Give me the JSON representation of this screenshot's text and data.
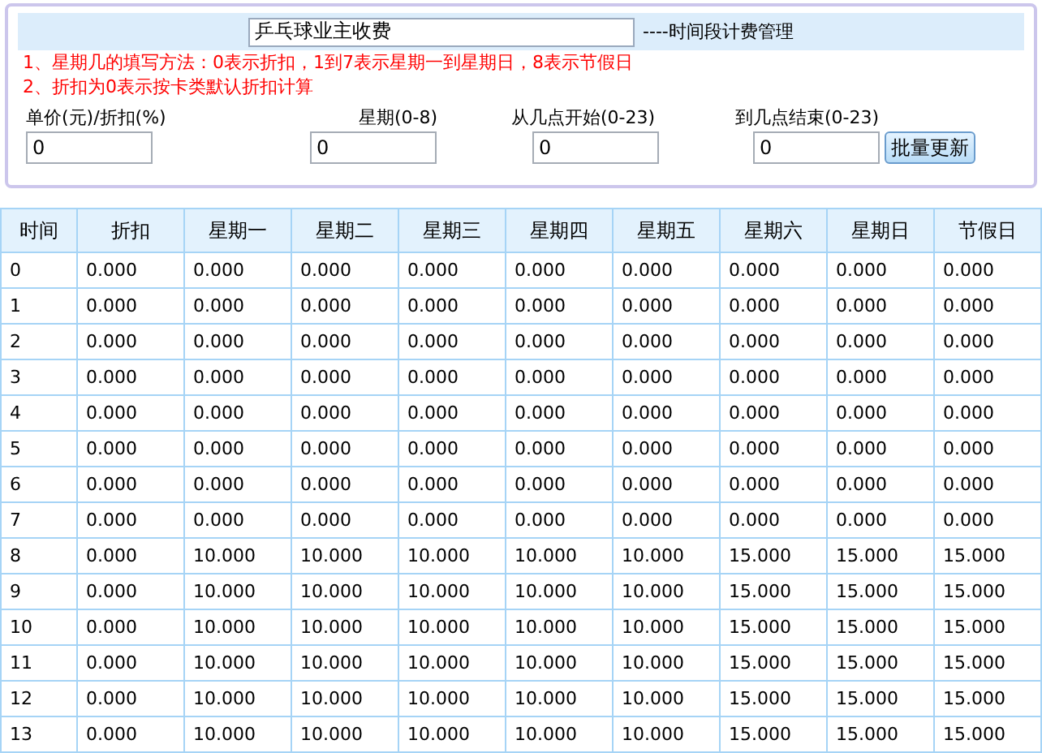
{
  "title_field": {
    "value": "乒乓球业主收费"
  },
  "title_suffix": "----时间段计费管理",
  "notes": [
    "1、星期几的填写方法：0表示折扣，1到7表示星期一到星期日，8表示节假日",
    "2、折扣为0表示按卡类默认折扣计算"
  ],
  "fields": [
    {
      "label": "单价(元)/折扣(%)",
      "value": "0"
    },
    {
      "label": "星期(0-8)",
      "value": "0"
    },
    {
      "label": "从几点开始(0-23)",
      "value": "0"
    },
    {
      "label": "到几点结束(0-23)",
      "value": "0"
    }
  ],
  "update_button": "批量更新",
  "table": {
    "columns": [
      "时间",
      "折扣",
      "星期一",
      "星期二",
      "星期三",
      "星期四",
      "星期五",
      "星期六",
      "星期日",
      "节假日"
    ],
    "rows": [
      [
        "0",
        "0.000",
        "0.000",
        "0.000",
        "0.000",
        "0.000",
        "0.000",
        "0.000",
        "0.000",
        "0.000"
      ],
      [
        "1",
        "0.000",
        "0.000",
        "0.000",
        "0.000",
        "0.000",
        "0.000",
        "0.000",
        "0.000",
        "0.000"
      ],
      [
        "2",
        "0.000",
        "0.000",
        "0.000",
        "0.000",
        "0.000",
        "0.000",
        "0.000",
        "0.000",
        "0.000"
      ],
      [
        "3",
        "0.000",
        "0.000",
        "0.000",
        "0.000",
        "0.000",
        "0.000",
        "0.000",
        "0.000",
        "0.000"
      ],
      [
        "4",
        "0.000",
        "0.000",
        "0.000",
        "0.000",
        "0.000",
        "0.000",
        "0.000",
        "0.000",
        "0.000"
      ],
      [
        "5",
        "0.000",
        "0.000",
        "0.000",
        "0.000",
        "0.000",
        "0.000",
        "0.000",
        "0.000",
        "0.000"
      ],
      [
        "6",
        "0.000",
        "0.000",
        "0.000",
        "0.000",
        "0.000",
        "0.000",
        "0.000",
        "0.000",
        "0.000"
      ],
      [
        "7",
        "0.000",
        "0.000",
        "0.000",
        "0.000",
        "0.000",
        "0.000",
        "0.000",
        "0.000",
        "0.000"
      ],
      [
        "8",
        "0.000",
        "10.000",
        "10.000",
        "10.000",
        "10.000",
        "10.000",
        "15.000",
        "15.000",
        "15.000"
      ],
      [
        "9",
        "0.000",
        "10.000",
        "10.000",
        "10.000",
        "10.000",
        "10.000",
        "15.000",
        "15.000",
        "15.000"
      ],
      [
        "10",
        "0.000",
        "10.000",
        "10.000",
        "10.000",
        "10.000",
        "10.000",
        "15.000",
        "15.000",
        "15.000"
      ],
      [
        "11",
        "0.000",
        "10.000",
        "10.000",
        "10.000",
        "10.000",
        "10.000",
        "15.000",
        "15.000",
        "15.000"
      ],
      [
        "12",
        "0.000",
        "10.000",
        "10.000",
        "10.000",
        "10.000",
        "10.000",
        "15.000",
        "15.000",
        "15.000"
      ],
      [
        "13",
        "0.000",
        "10.000",
        "10.000",
        "10.000",
        "10.000",
        "10.000",
        "15.000",
        "15.000",
        "15.000"
      ]
    ]
  }
}
